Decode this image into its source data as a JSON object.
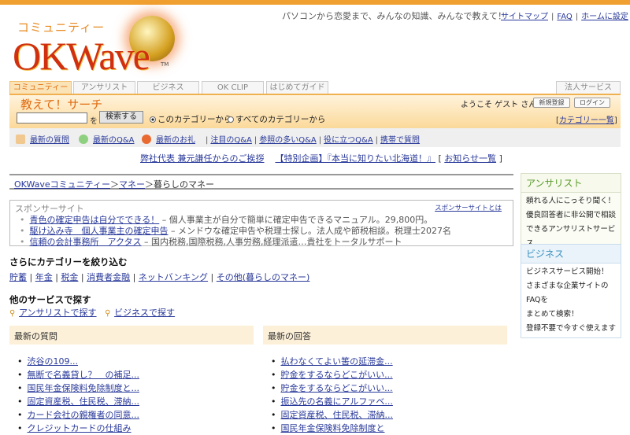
{
  "header": {
    "logo_sub": "コミュニティー",
    "logo_main": "OKWave",
    "logo_tm": "TM",
    "tagline": "パソコンから恋愛まで、みんなの知識、みんなで教えて！",
    "links": [
      "サイトマップ",
      "FAQ",
      "ホームに設定"
    ]
  },
  "tabs": [
    "コミュニティー",
    "アンサリスト",
    "ビジネス",
    "OK CLIP",
    "はじめてガイド"
  ],
  "corporate_tab": "法人サービス",
  "search": {
    "title": "教えて！サーチ",
    "input_value": "",
    "wo": "を",
    "button": "検索する",
    "radio_this": "このカテゴリーから",
    "radio_all": "すべてのカテゴリーから",
    "welcome": "ようこそ ゲスト さん",
    "register": "新規登録",
    "login": "ログイン",
    "category_list": "カテゴリー一覧",
    "bracket_open": "[",
    "bracket_close": "]"
  },
  "nav": {
    "latest_question": "最新の質問",
    "latest_qa": "最新のQ&A",
    "latest_thanks": "最新のお礼",
    "links": [
      "注目のQ&A",
      "参照の多いQ&A",
      "役に立つQ&A",
      "携帯で質問"
    ]
  },
  "notice": {
    "items": [
      "弊社代表 兼元謙任からのご挨拶",
      "【特別企画】『本当に知りたい北海道！』"
    ],
    "all": "お知らせ一覧"
  },
  "breadcrumb": {
    "items": [
      "OKWaveコミュニティー",
      "マネー"
    ],
    "current": "暮らしのマネー",
    "sep": "＞"
  },
  "sponsor": {
    "title": "スポンサーサイト",
    "what": "スポンサーサイトとは",
    "items": [
      {
        "link": "青色の確定申告は自分でできる！",
        "desc": " – 個人事業主が自分で簡単に確定申告できるマニュアル。29,800円。"
      },
      {
        "link": "駆け込み寺　個人事業主の確定申告",
        "desc": " – メンドウな確定申告や税理士探し。法人成や節税相談。税理士2027名"
      },
      {
        "link": "信頼の会計事務所　アクタス",
        "desc": " – 国内税務,国際税務,人事労務,経理派遣…貴社をトータルサポート"
      }
    ]
  },
  "narrow": {
    "title": "さらにカテゴリーを絞り込む",
    "items": [
      "貯蓄",
      "年金",
      "税金",
      "消費者金融",
      "ネットバンキング",
      "その他(暮らしのマネー)"
    ]
  },
  "services": {
    "title": "他のサービスで探す",
    "items": [
      "アンサリストで探す",
      "ビジネスで探す"
    ]
  },
  "latest_questions": {
    "title": "最新の質問",
    "items": [
      "渋谷の109...",
      "無断で名義貸し？　の補足...",
      "国民年金保険料免除制度と...",
      "固定資産税、住民税、滞納...",
      "カード会社の親権者の同意...",
      "クレジットカードの仕組み"
    ]
  },
  "latest_answers": {
    "title": "最新の回答",
    "items": [
      "払わなくてよい筈の延滞金...",
      "貯金をするならどこがいい...",
      "貯金をするならどこがいい...",
      "振込先の名義にアルファベ...",
      "固定資産税、住民税、滞納...",
      "国民年金保険料免除制度と"
    ]
  },
  "sidebar": {
    "answerist": {
      "title": "アンサリスト",
      "lines": [
        "頼れる人にこっそり聞く！",
        "優良回答者に非公開で相談",
        "できるアンサリストサービス"
      ]
    },
    "business": {
      "title": "ビジネス",
      "lines": [
        "ビジネスサービス開始！",
        "さまざまな企業サイトのFAQを",
        "まとめて検索！",
        "登録不要で今すぐ使えます"
      ]
    }
  },
  "colors": {
    "accent": "#f0a030",
    "orange_text": "#e06a10",
    "link": "#2a3a9a",
    "answerist": "#5a9a2a",
    "business": "#3a90c0"
  }
}
